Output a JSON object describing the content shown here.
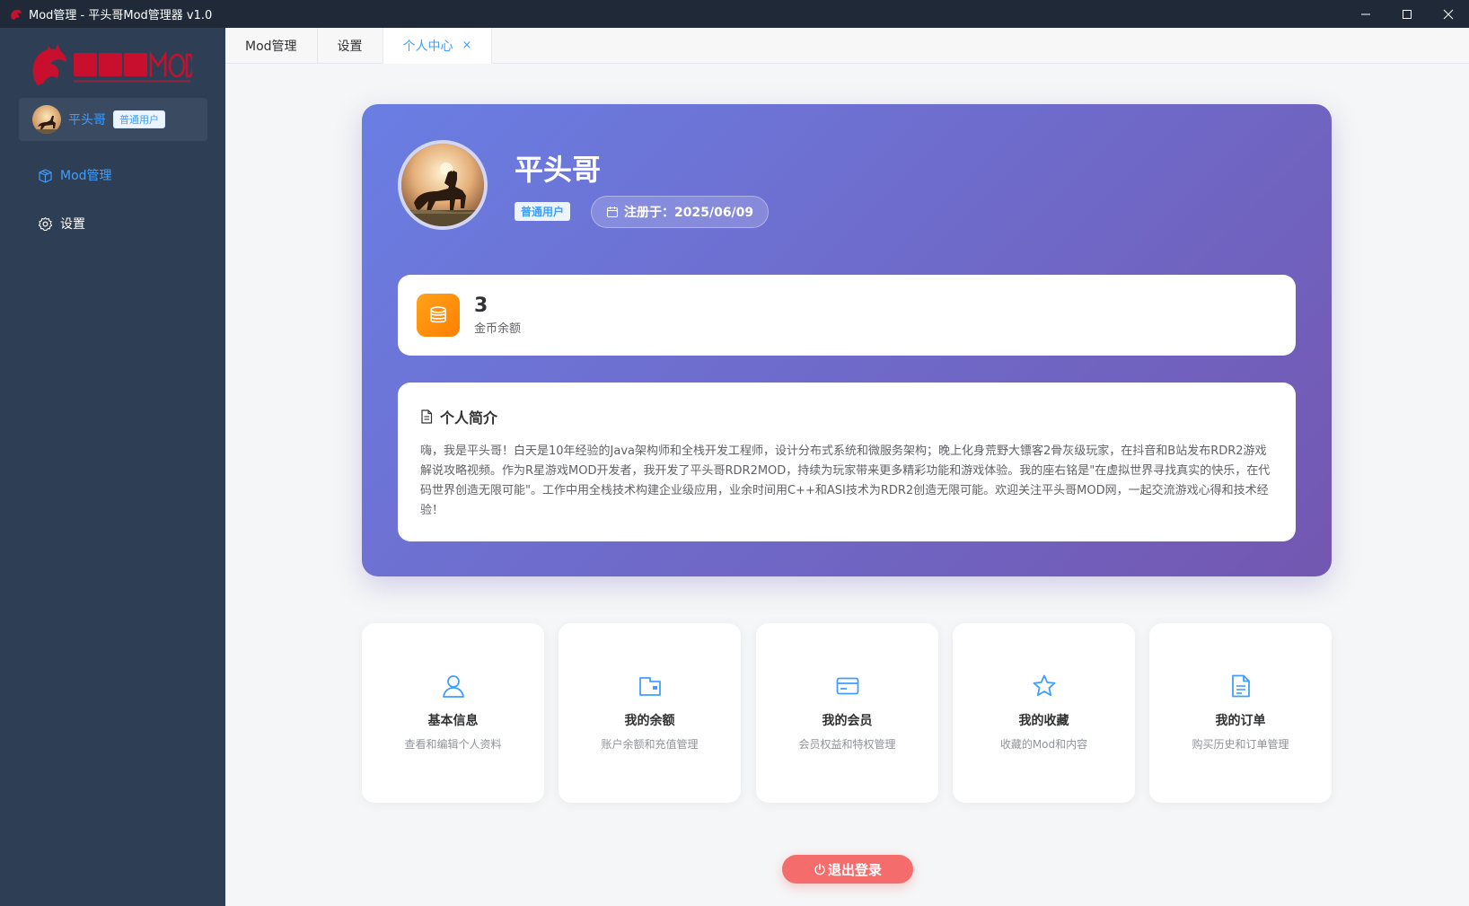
{
  "window": {
    "title": "Mod管理 - 平头哥Mod管理器 v1.0",
    "controls": [
      "minimize",
      "maximize",
      "close"
    ]
  },
  "sidebar": {
    "user": {
      "name": "平头哥",
      "badge": "普通用户"
    },
    "items": [
      {
        "label": "Mod管理",
        "icon": "box-icon",
        "active": true
      },
      {
        "label": "设置",
        "icon": "gear-icon",
        "active": false
      }
    ]
  },
  "tabs": [
    {
      "label": "Mod管理",
      "active": false,
      "closable": false
    },
    {
      "label": "设置",
      "active": false,
      "closable": false
    },
    {
      "label": "个人中心",
      "active": true,
      "closable": true,
      "close_glyph": "×"
    }
  ],
  "profile": {
    "name": "平头哥",
    "badge": "普通用户",
    "register_date": "注册于：2025/06/09",
    "coins": {
      "value": "3",
      "label": "金币余额"
    },
    "bio": {
      "title": "个人简介",
      "text": "嗨，我是平头哥！白天是10年经验的Java架构师和全栈开发工程师，设计分布式系统和微服务架构；晚上化身荒野大镖客2骨灰级玩家，在抖音和B站发布RDR2游戏解说攻略视频。作为R星游戏MOD开发者，我开发了平头哥RDR2MOD，持续为玩家带来更多精彩功能和游戏体验。我的座右铭是\"在虚拟世界寻找真实的快乐，在代码世界创造无限可能\"。工作中用全栈技术构建企业级应用，业余时间用C++和ASI技术为RDR2创造无限可能。欢迎关注平头哥MOD网，一起交流游戏心得和技术经验！"
    }
  },
  "quick_cards": [
    {
      "title": "基本信息",
      "desc": "查看和编辑个人资料",
      "icon": "user-icon"
    },
    {
      "title": "我的余额",
      "desc": "账户余额和充值管理",
      "icon": "wallet-icon"
    },
    {
      "title": "我的会员",
      "desc": "会员权益和特权管理",
      "icon": "card-icon"
    },
    {
      "title": "我的收藏",
      "desc": "收藏的Mod和内容",
      "icon": "star-icon"
    },
    {
      "title": "我的订单",
      "desc": "购买历史和订单管理",
      "icon": "document-icon"
    }
  ],
  "logout_label": "退出登录",
  "colors": {
    "accent": "#409eff",
    "sidebar": "#2e3f55",
    "hero_start": "#6a7ee3",
    "hero_end": "#7357b1",
    "coin": "#ff8c00",
    "logout": "#f56c6c",
    "logo_red": "#c8102e"
  }
}
